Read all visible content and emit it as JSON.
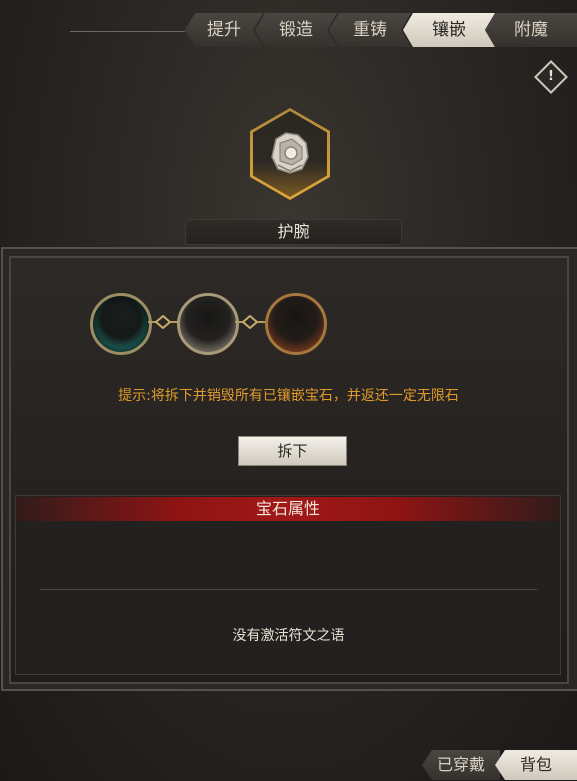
{
  "tabs": {
    "upgrade": "提升",
    "forge": "锻造",
    "recast": "重铸",
    "inlay": "镶嵌",
    "enchant": "附魔",
    "active": "镶嵌"
  },
  "item": {
    "name": "护腕",
    "icon": "bracer-icon"
  },
  "info_icon": "!",
  "sockets": [
    {
      "color": "#3bb3a4",
      "state": "empty"
    },
    {
      "color": "#bdb5a5",
      "state": "empty"
    },
    {
      "color": "#c6652d",
      "state": "empty"
    }
  ],
  "hint": "提示:将拆下并销毁所有已镶嵌宝石，并返还一定无限石",
  "remove_button": "拆下",
  "gem_section": {
    "title": "宝石属性",
    "empty_text": "没有激活符文之语"
  },
  "bottom_tabs": {
    "equipped": "已穿戴",
    "bag": "背包",
    "active": "背包"
  },
  "colors": {
    "accent_gold": "#e0a637",
    "hint_orange": "#e09a2c",
    "header_red": "#a01818"
  }
}
